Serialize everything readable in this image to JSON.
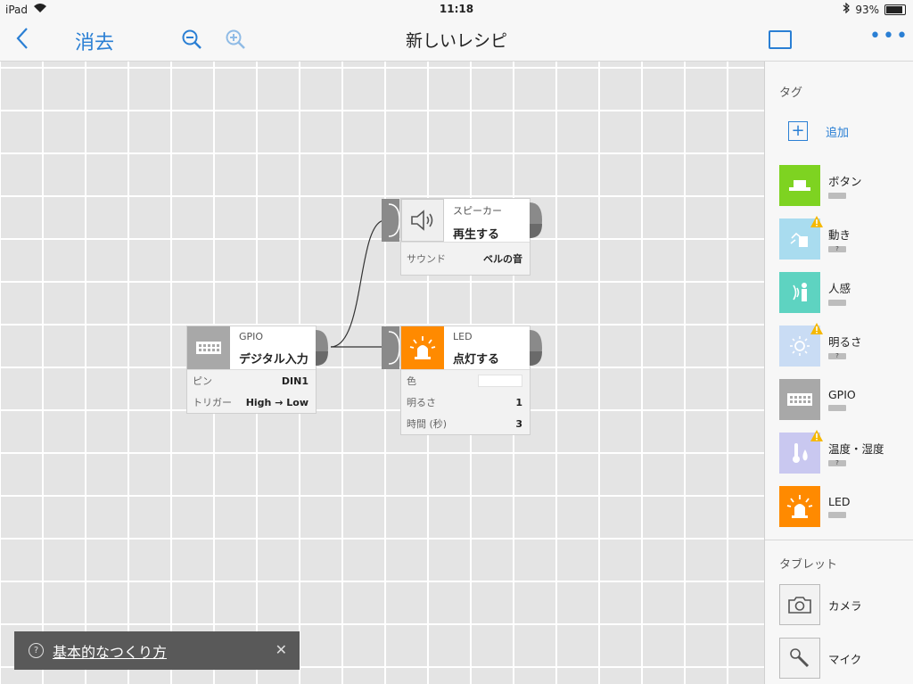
{
  "status_bar": {
    "device": "iPad",
    "time": "11:18",
    "battery": "93%"
  },
  "nav": {
    "erase_label": "消去",
    "title": "新しいレシピ",
    "more_label": "•••"
  },
  "canvas": {
    "nodes": {
      "gpio": {
        "type": "GPIO",
        "action": "デジタル入力",
        "props": [
          {
            "label": "ピン",
            "value": "DIN1"
          },
          {
            "label": "トリガー",
            "value": "High → Low"
          }
        ]
      },
      "speaker": {
        "type": "スピーカー",
        "action": "再生する",
        "props": [
          {
            "label": "サウンド",
            "value": "ベルの音"
          }
        ]
      },
      "led": {
        "type": "LED",
        "action": "点灯する",
        "props": [
          {
            "label": "色",
            "value": ""
          },
          {
            "label": "明るさ",
            "value": "1"
          },
          {
            "label": "時間 (秒)",
            "value": "3"
          }
        ]
      }
    }
  },
  "sidebar": {
    "tags_title": "タグ",
    "add_label": "追加",
    "tags": [
      {
        "name": "ボタン",
        "badge": "",
        "color": "#7ed321",
        "icon": "button-icon"
      },
      {
        "name": "動き",
        "badge": "?",
        "color": "#a9dcef",
        "icon": "motion-icon"
      },
      {
        "name": "人感",
        "badge": "",
        "color": "#5ed3c1",
        "icon": "human-sensor-icon"
      },
      {
        "name": "明るさ",
        "badge": "?",
        "color": "#c9dcf4",
        "icon": "brightness-icon"
      },
      {
        "name": "GPIO",
        "badge": "",
        "color": "#a8a8a8",
        "icon": "gpio-icon"
      },
      {
        "name": "温度・湿度",
        "badge": "?",
        "color": "#c9c8f0",
        "icon": "thermometer-icon"
      },
      {
        "name": "LED",
        "badge": "",
        "color": "#ff8a00",
        "icon": "led-icon"
      }
    ],
    "tablet_title": "タブレット",
    "tablet_items": [
      {
        "name": "カメラ",
        "icon": "camera-icon"
      },
      {
        "name": "マイク",
        "icon": "microphone-icon"
      }
    ]
  },
  "toast": {
    "text": "基本的なつくり方"
  }
}
